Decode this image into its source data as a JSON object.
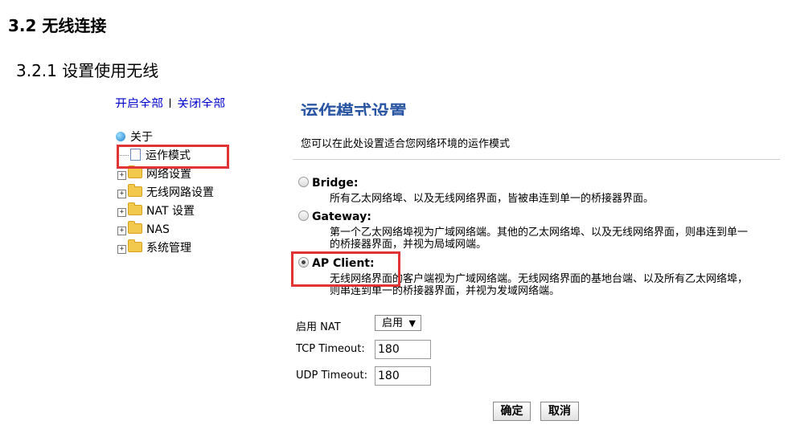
{
  "doc": {
    "section_title": "3.2 无线连接",
    "subsection_title": "3.2.1 设置使用无线"
  },
  "tree": {
    "top_link_open": "开启全部",
    "top_link_sep": "|",
    "top_link_close": "关闭全部",
    "root_label": "关于",
    "items": [
      {
        "label": "运作模式",
        "type": "doc"
      },
      {
        "label": "网络设置",
        "type": "folder"
      },
      {
        "label": "无线网路设置",
        "type": "folder"
      },
      {
        "label": "NAT 设置",
        "type": "folder"
      },
      {
        "label": "NAS",
        "type": "folder"
      },
      {
        "label": "系统管理",
        "type": "folder"
      }
    ]
  },
  "panel": {
    "title": "运作模式设置",
    "description": "您可以在此处设置适合您网络环境的运作模式",
    "modes": [
      {
        "label": "Bridge:",
        "desc": "所有乙太网络埠、以及无线网络界面，皆被串连到单一的桥接器界面。",
        "checked": false
      },
      {
        "label": "Gateway:",
        "desc_line1": "第一个乙太网络埠视为广域网络端。其他的乙太网络埠、以及无线网络界面，则串连到单一",
        "desc_line2": "的桥接器界面，并视为局域网端。",
        "checked": false
      },
      {
        "label": "AP Client:",
        "desc_line1": "无线网络界面的客户端视为广域网络端。无线网络界面的基地台端、以及所有乙太网络埠，",
        "desc_line2": "则串连到单一的桥接器界面，并视为发域网络端。",
        "checked": true
      }
    ],
    "nat_label": "启用 NAT",
    "nat_value": "启用",
    "tcp_label": "TCP Timeout:",
    "tcp_value": "180",
    "udp_label": "UDP Timeout:",
    "udp_value": "180",
    "ok_label": "确定",
    "cancel_label": "取消"
  },
  "colors": {
    "highlight": "#e23434",
    "link": "#0000cc",
    "panel_title": "#2a56a4"
  }
}
